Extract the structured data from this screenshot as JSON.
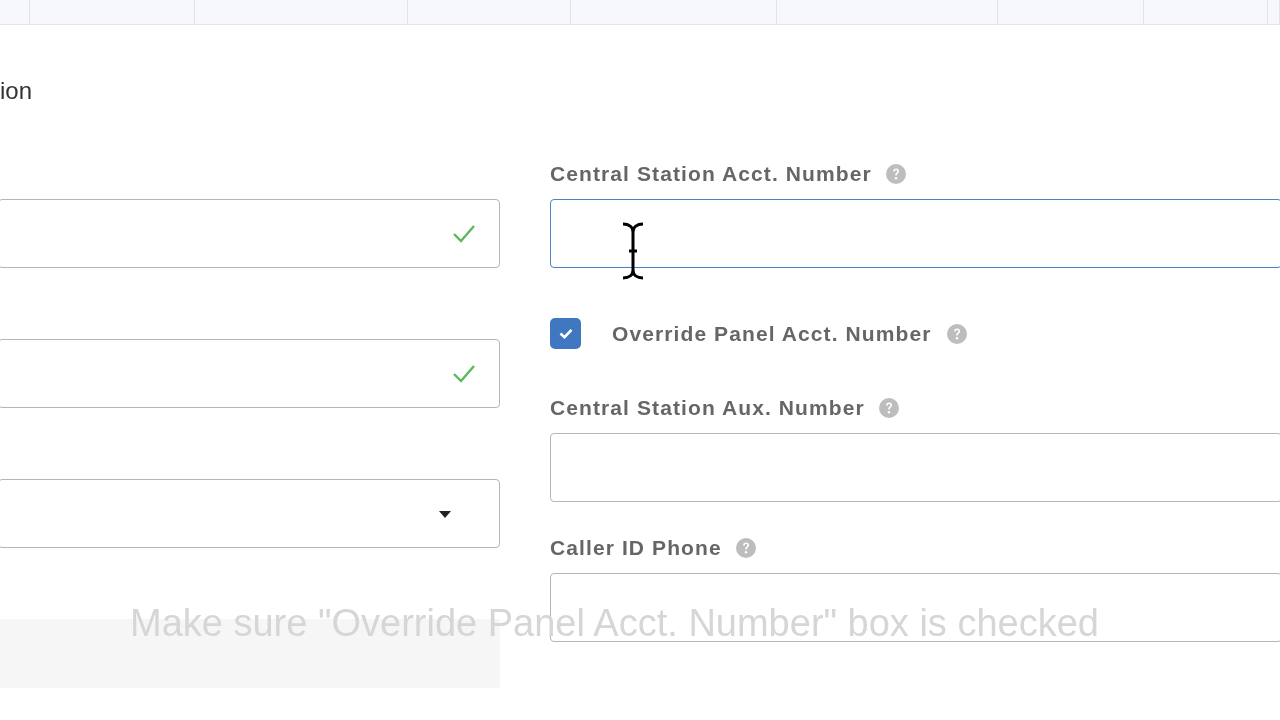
{
  "section": {
    "title": "ion"
  },
  "left_fields": [
    {
      "kind": "text",
      "valid": true
    },
    {
      "kind": "text",
      "valid": true
    },
    {
      "kind": "select"
    },
    {
      "kind": "disabled"
    }
  ],
  "right_fields": [
    {
      "kind": "input",
      "label": "Central Station Acct. Number",
      "help": true,
      "focused": true
    },
    {
      "kind": "checkbox",
      "label": "Override Panel Acct. Number",
      "help": true,
      "checked": true
    },
    {
      "kind": "input",
      "label": "Central Station Aux. Number",
      "help": true,
      "focused": false
    },
    {
      "kind": "input",
      "label": "Caller ID Phone",
      "help": true,
      "focused": false
    }
  ],
  "caption": "Make sure \"Override Panel Acct. Number\" box is checked"
}
